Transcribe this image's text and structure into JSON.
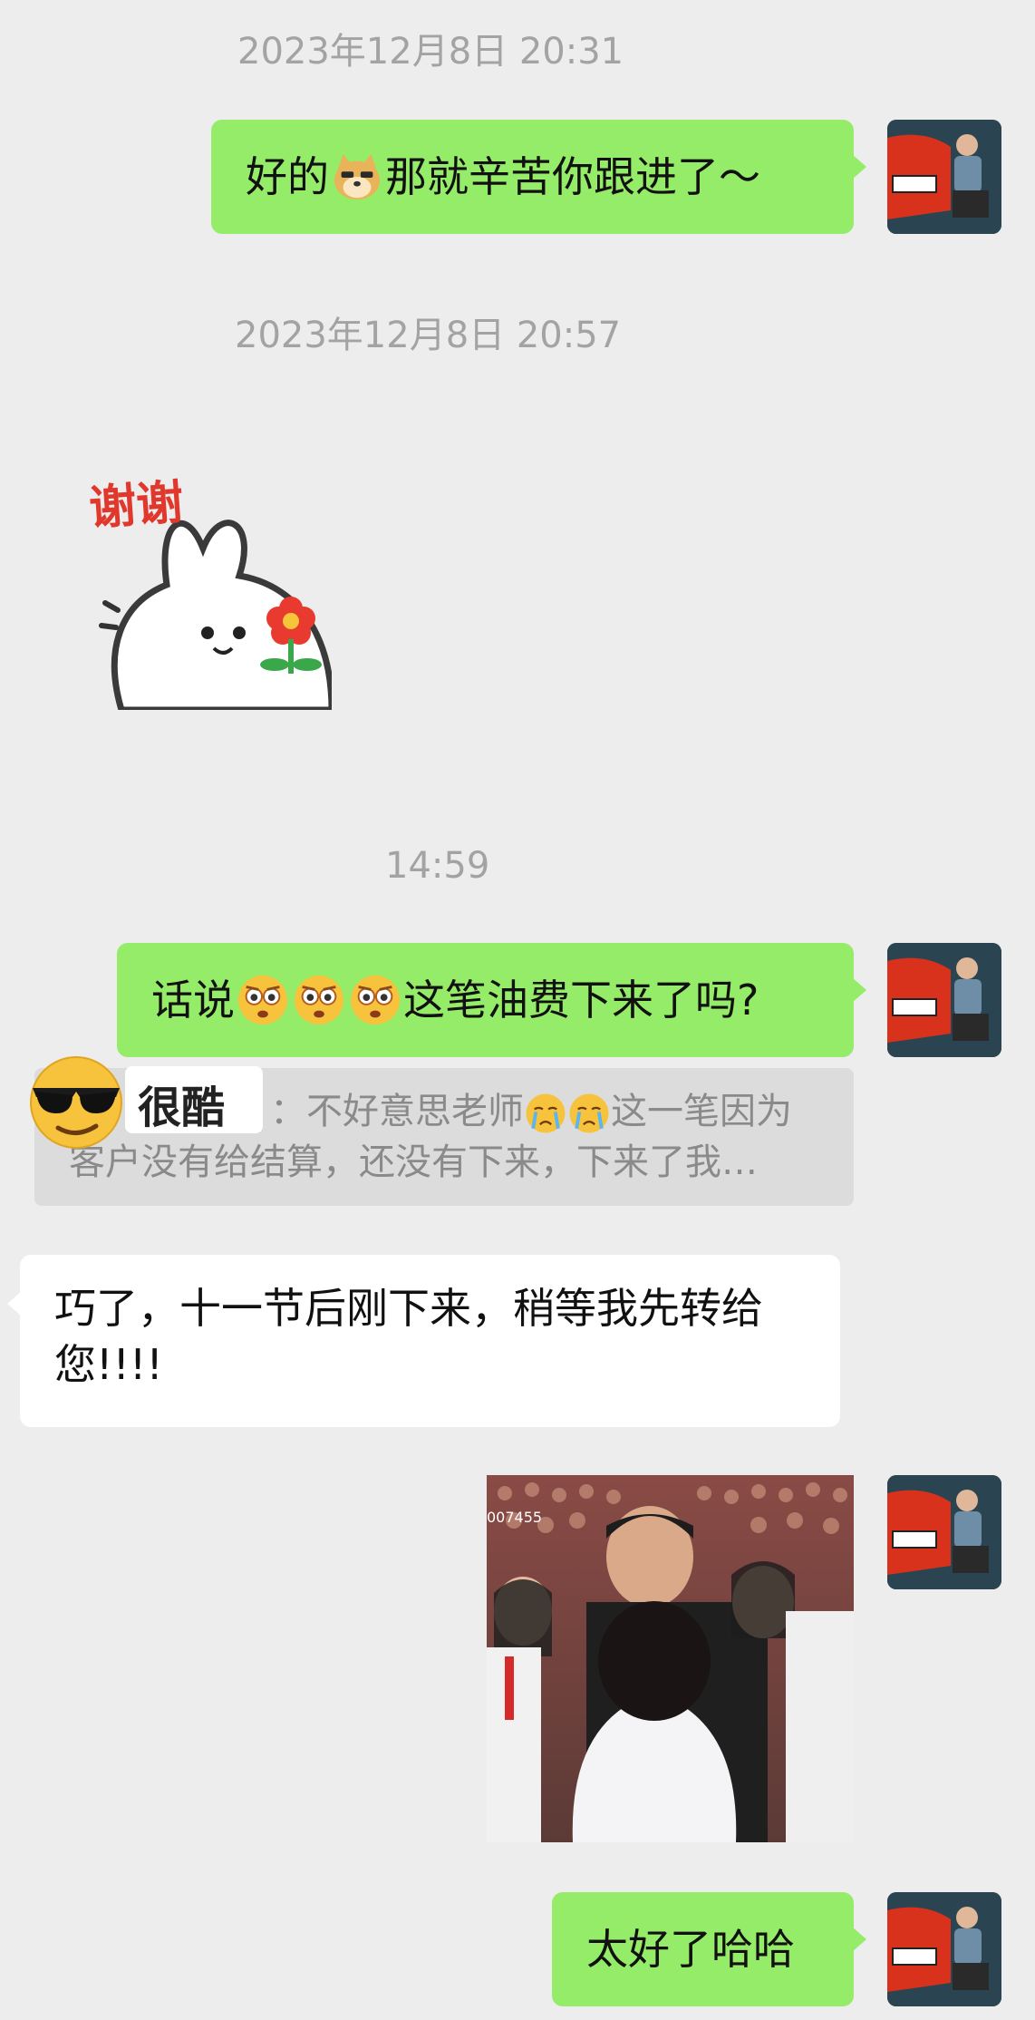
{
  "messages": {
    "ts1": "2023年12月8日 20:31",
    "msg1_a": "好的",
    "msg1_b": "那就辛苦你跟进了～",
    "ts2": "2023年12月8日 20:57",
    "sticker_text": "谢谢",
    "ts3": "14:59",
    "msg2_a": "话说",
    "msg2_b": "这笔油费下来了吗?",
    "quote_prefix": "：不好意思老师",
    "quote_mid": "这一笔因为",
    "quote_line2": "客户没有给结算，还没有下来，下来了我…",
    "overlay_label": "很酷",
    "msg3": "巧了，十一节后刚下来，稍等我先转给您!!!!",
    "photo_watermark": "007455",
    "msg4": "太好了哈哈"
  },
  "colors": {
    "background": "#ededed",
    "my_bubble": "#95ec69",
    "their_bubble": "#ffffff",
    "timestamp": "#a3a3a3"
  }
}
